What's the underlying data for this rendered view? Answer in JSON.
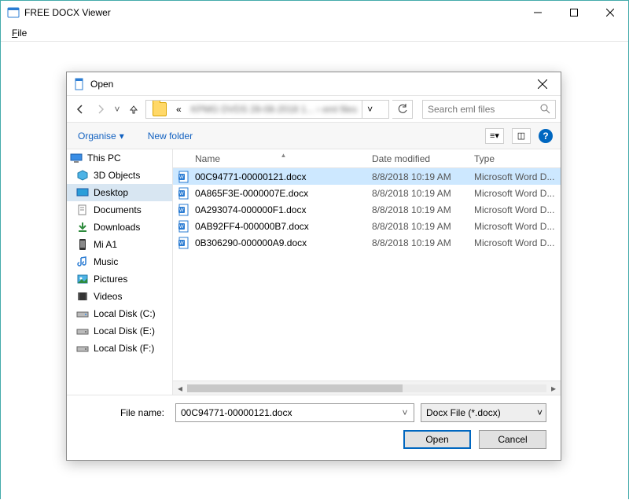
{
  "app": {
    "title": "FREE DOCX Viewer",
    "menu": {
      "file": "File"
    }
  },
  "dialog": {
    "title": "Open",
    "nav": {
      "breadcrumb_blur": "KPMG DVDS 28-08-2018 1...  ›  eml files"
    },
    "search": {
      "placeholder": "Search eml files"
    },
    "toolbar": {
      "organise": "Organise",
      "newfolder": "New folder"
    },
    "columns": {
      "name": "Name",
      "date": "Date modified",
      "type": "Type"
    },
    "sidebar": {
      "root": "This PC",
      "items": [
        {
          "label": "3D Objects"
        },
        {
          "label": "Desktop"
        },
        {
          "label": "Documents"
        },
        {
          "label": "Downloads"
        },
        {
          "label": "Mi A1"
        },
        {
          "label": "Music"
        },
        {
          "label": "Pictures"
        },
        {
          "label": "Videos"
        },
        {
          "label": "Local Disk (C:)"
        },
        {
          "label": "Local Disk (E:)"
        },
        {
          "label": "Local Disk (F:)"
        }
      ]
    },
    "files": [
      {
        "name": "00C94771-00000121.docx",
        "date": "8/8/2018 10:19 AM",
        "type": "Microsoft Word D..."
      },
      {
        "name": "0A865F3E-0000007E.docx",
        "date": "8/8/2018 10:19 AM",
        "type": "Microsoft Word D..."
      },
      {
        "name": "0A293074-000000F1.docx",
        "date": "8/8/2018 10:19 AM",
        "type": "Microsoft Word D..."
      },
      {
        "name": "0AB92FF4-000000B7.docx",
        "date": "8/8/2018 10:19 AM",
        "type": "Microsoft Word D..."
      },
      {
        "name": "0B306290-000000A9.docx",
        "date": "8/8/2018 10:19 AM",
        "type": "Microsoft Word D..."
      }
    ],
    "footer": {
      "filename_label": "File name:",
      "filename_value": "00C94771-00000121.docx",
      "filter": "Docx File (*.docx)",
      "open": "Open",
      "cancel": "Cancel"
    }
  }
}
